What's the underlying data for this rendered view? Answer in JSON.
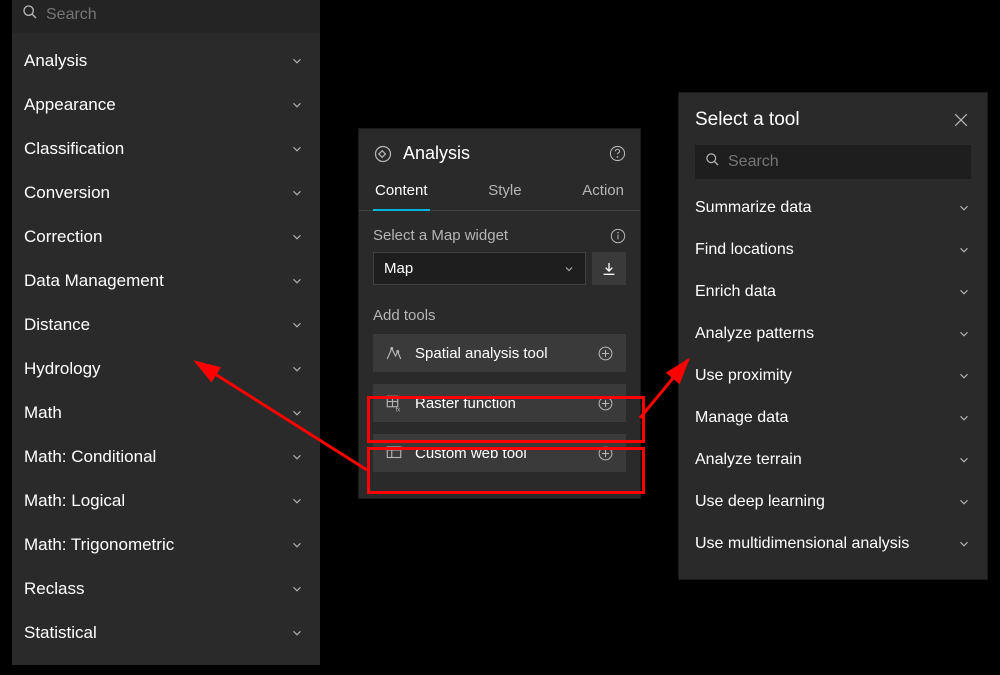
{
  "left_panel": {
    "search_placeholder": "Search",
    "categories": [
      "Analysis",
      "Appearance",
      "Classification",
      "Conversion",
      "Correction",
      "Data Management",
      "Distance",
      "Hydrology",
      "Math",
      "Math: Conditional",
      "Math: Logical",
      "Math: Trigonometric",
      "Reclass",
      "Statistical"
    ]
  },
  "analysis_panel": {
    "title": "Analysis",
    "tabs": {
      "content": "Content",
      "style": "Style",
      "action": "Action"
    },
    "select_map_label": "Select a Map widget",
    "map_value": "Map",
    "add_tools_label": "Add tools",
    "tools": {
      "spatial": "Spatial analysis tool",
      "raster": "Raster function",
      "custom": "Custom web tool"
    }
  },
  "tool_panel": {
    "title": "Select a tool",
    "search_placeholder": "Search",
    "items": [
      "Summarize data",
      "Find locations",
      "Enrich data",
      "Analyze patterns",
      "Use proximity",
      "Manage data",
      "Analyze terrain",
      "Use deep learning",
      "Use multidimensional analysis"
    ]
  },
  "colors": {
    "highlight": "#ff0000",
    "accent": "#00b5d8"
  }
}
